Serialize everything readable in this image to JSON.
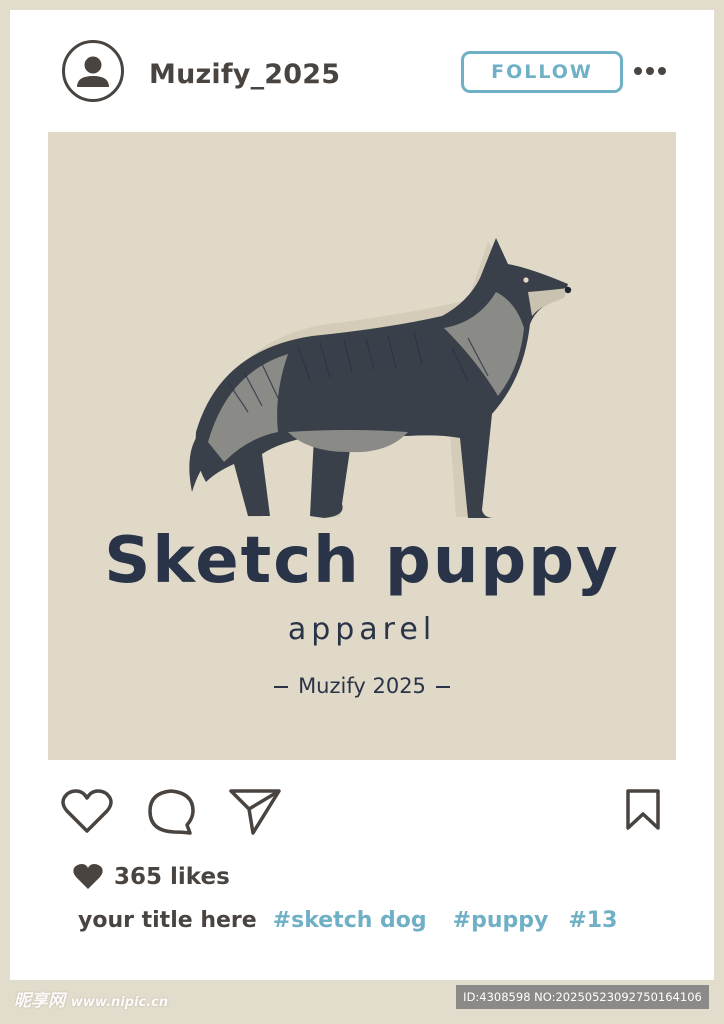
{
  "post": {
    "username": "Muzify_2025",
    "follow_label": "FOLLOW",
    "likes": "365 likes",
    "caption_title": "your title here",
    "hashtags": [
      "#sketch dog",
      "#puppy",
      "#13"
    ]
  },
  "artwork": {
    "title": "Sketch puppy",
    "subtitle": "apparel",
    "credit": "Muzify 2025"
  },
  "watermark": {
    "site_cn": "昵享网",
    "site_url": "www.nipic.cn",
    "id_text": "ID:4308598 NO:20250523092750164106"
  },
  "icons": {
    "avatar": "user-avatar-icon",
    "more": "more-dots-icon",
    "like": "heart-outline-icon",
    "comment": "comment-bubble-icon",
    "share": "paper-plane-icon",
    "save": "bookmark-icon",
    "likes": "heart-filled-icon"
  },
  "colors": {
    "background": "#e2dccd",
    "card": "#ffffff",
    "text": "#4a4440",
    "accent": "#6fb0c6",
    "image_bg": "#e0d9c8",
    "ink": "#2a3448"
  }
}
